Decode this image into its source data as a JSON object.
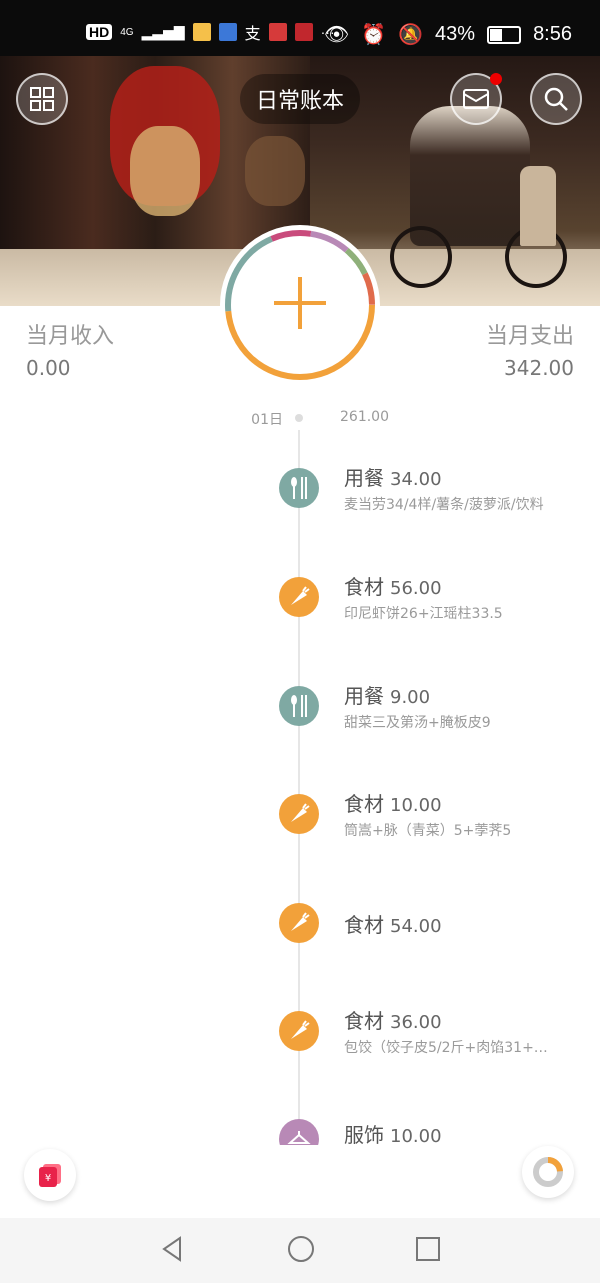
{
  "status_bar": {
    "left_labels": [
      "HD",
      "4G",
      "支"
    ],
    "battery_percent": "43%",
    "time": "8:56"
  },
  "header": {
    "title": "日常账本",
    "grid_icon": "grid-icon",
    "mail_icon": "mail-icon",
    "search_icon": "search-icon",
    "has_unread_dot": true
  },
  "summary": {
    "income_label": "当月收入",
    "income_value": "0.00",
    "expense_label": "当月支出",
    "expense_value": "342.00"
  },
  "day": {
    "date": "01日",
    "total": "261.00"
  },
  "entries": [
    {
      "category": "用餐",
      "amount": "34.00",
      "note": "麦当劳34/4样/薯条/菠萝派/饮料",
      "icon": "utensils-icon",
      "color": "#7fa9a3"
    },
    {
      "category": "食材",
      "amount": "56.00",
      "note": "印尼虾饼26+江瑶柱33.5",
      "icon": "carrot-icon",
      "color": "#f2a13a"
    },
    {
      "category": "用餐",
      "amount": "9.00",
      "note": "甜菜三及第汤+腌板皮9",
      "icon": "utensils-icon",
      "color": "#7fa9a3"
    },
    {
      "category": "食材",
      "amount": "10.00",
      "note": "筒嵩+脉（青菜）5+荸荠5",
      "icon": "carrot-icon",
      "color": "#f2a13a"
    },
    {
      "category": "食材",
      "amount": "54.00",
      "note": "",
      "icon": "carrot-icon",
      "color": "#f2a13a"
    },
    {
      "category": "食材",
      "amount": "36.00",
      "note": "包饺（饺子皮5/2斤+肉馅31+…",
      "icon": "carrot-icon",
      "color": "#f2a13a"
    },
    {
      "category": "服饰",
      "amount": "10.00",
      "note": "",
      "icon": "hanger-icon",
      "color": "#b889b6"
    }
  ],
  "colors": {
    "accent_orange": "#f2a13a",
    "teal": "#7fa9a3",
    "purple": "#b889b6"
  }
}
